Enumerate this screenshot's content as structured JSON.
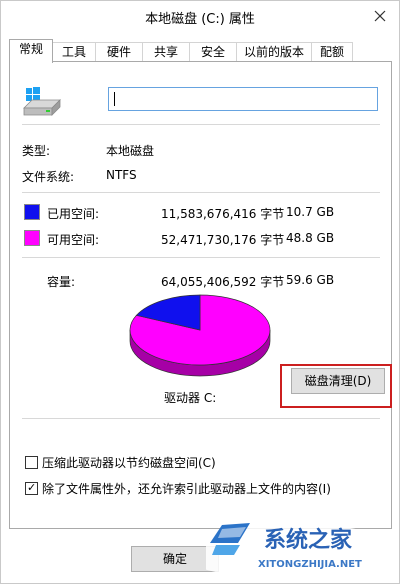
{
  "window": {
    "title": "本地磁盘 (C:) 属性"
  },
  "tabs": [
    {
      "label": "常规",
      "active": true
    },
    {
      "label": "工具"
    },
    {
      "label": "硬件"
    },
    {
      "label": "共享"
    },
    {
      "label": "安全"
    },
    {
      "label": "以前的版本"
    },
    {
      "label": "配额"
    }
  ],
  "general": {
    "name_value": "",
    "type_label": "类型:",
    "type_value": "本地磁盘",
    "fs_label": "文件系统:",
    "fs_value": "NTFS",
    "used": {
      "label": "已用空间:",
      "bytes": "11,583,676,416 字节",
      "size": "10.7 GB",
      "color": "#1010ee"
    },
    "free": {
      "label": "可用空间:",
      "bytes": "52,471,730,176 字节",
      "size": "48.8 GB",
      "color": "#ff00ff"
    },
    "capacity": {
      "label": "容量:",
      "bytes": "64,055,406,592 字节",
      "size": "59.6 GB"
    },
    "pie_used_fraction": 0.181,
    "drive_label": "驱动器 C:",
    "cleanup_button": "磁盘清理(D)"
  },
  "options": {
    "compress": {
      "label": "压缩此驱动器以节约磁盘空间(C)",
      "checked": false
    },
    "index": {
      "label": "除了文件属性外，还允许索引此驱动器上文件的内容(I)",
      "checked": true
    }
  },
  "buttons": {
    "ok": "确定"
  },
  "watermark": {
    "brand": "系统之家",
    "url": "XITONGZHIJIA.NET"
  },
  "icons": {
    "close": "close-icon",
    "drive": "drive-icon"
  }
}
